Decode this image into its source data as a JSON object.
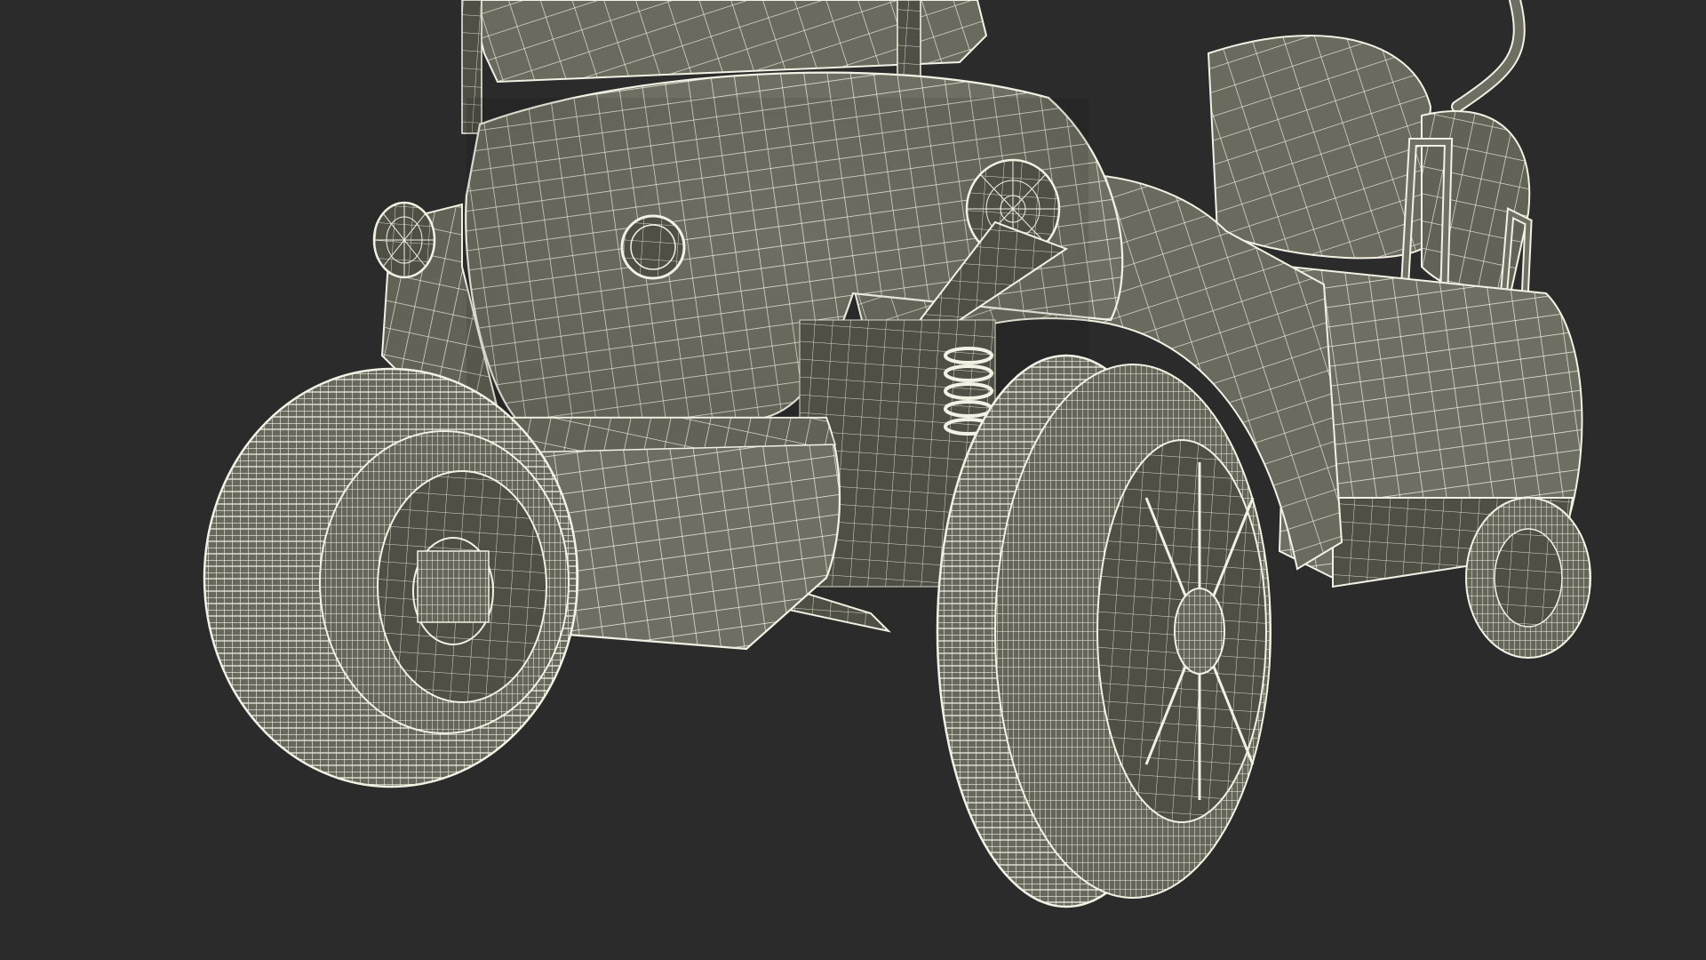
{
  "scene": {
    "subject": "golf-cart-wireframe-model",
    "background_color": "#2b2b2b",
    "surface_color": "#6e6e62",
    "surface_dark_color": "#55554b",
    "wire_color": "#f2f2e4",
    "view": "front-left-low-angle"
  },
  "parts": [
    {
      "name": "roof-canopy",
      "icon": "canopy-panel"
    },
    {
      "name": "front-cowl",
      "icon": "body-panel"
    },
    {
      "name": "left-headlight",
      "icon": "round-lamp"
    },
    {
      "name": "right-headlight",
      "icon": "round-lamp"
    },
    {
      "name": "emblem",
      "icon": "round-badge"
    },
    {
      "name": "front-bumper",
      "icon": "bumper-block"
    },
    {
      "name": "right-fender",
      "icon": "fender-arch"
    },
    {
      "name": "front-left-wheel",
      "icon": "tire-wheel"
    },
    {
      "name": "front-right-wheel",
      "icon": "tire-wheel"
    },
    {
      "name": "rear-right-wheel",
      "icon": "tire-wheel"
    },
    {
      "name": "suspension-spring",
      "icon": "coil-spring"
    },
    {
      "name": "seat",
      "icon": "seat-cushion"
    },
    {
      "name": "rear-grab-rails",
      "icon": "tube-rail"
    },
    {
      "name": "side-body-panel",
      "icon": "body-panel"
    }
  ]
}
